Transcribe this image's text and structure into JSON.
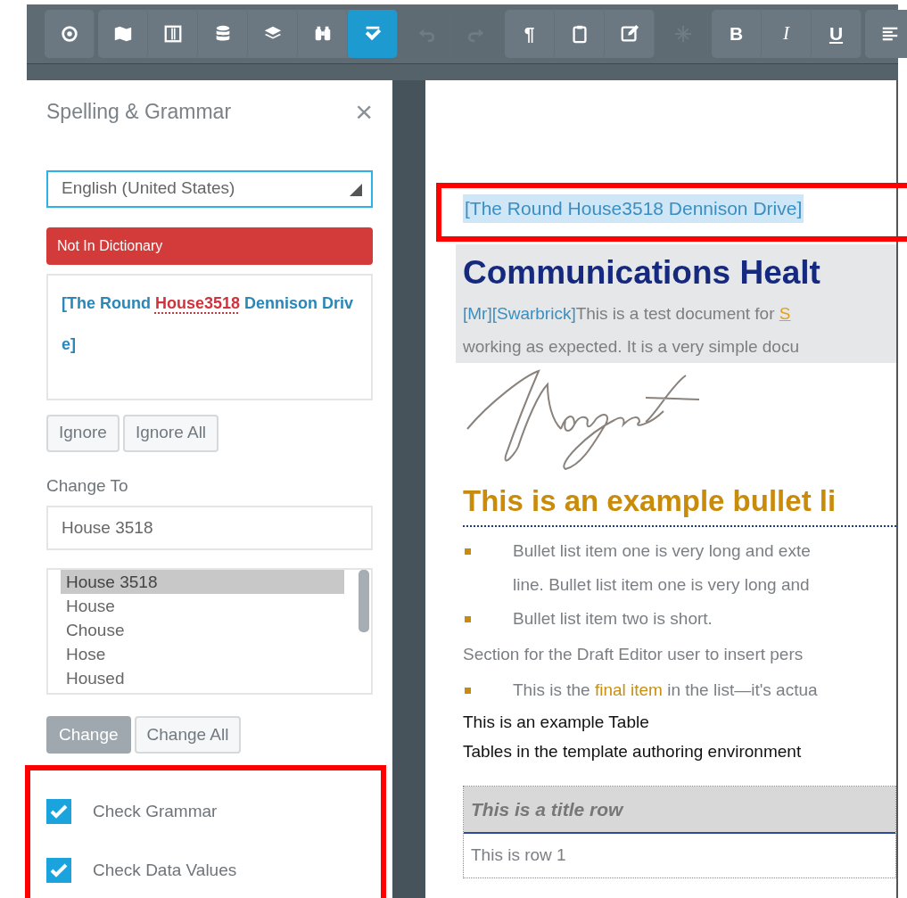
{
  "toolbar": {
    "groups": [
      {
        "buttons": [
          {
            "active": false,
            "disabled": false
          }
        ]
      },
      {
        "buttons": [
          {
            "active": false,
            "disabled": false
          },
          {
            "active": false,
            "disabled": false
          },
          {
            "active": false,
            "disabled": false
          },
          {
            "active": false,
            "disabled": false
          },
          {
            "active": false,
            "disabled": false
          },
          {
            "active": true,
            "disabled": false
          }
        ]
      },
      {
        "buttons": [
          {
            "active": false,
            "disabled": true
          },
          {
            "active": false,
            "disabled": true
          }
        ]
      },
      {
        "buttons": [
          {
            "label": "¶",
            "active": false,
            "disabled": false
          },
          {
            "active": false,
            "disabled": false
          },
          {
            "active": false,
            "disabled": false
          }
        ]
      },
      {
        "buttons": [
          {
            "active": false,
            "disabled": true
          }
        ]
      },
      {
        "buttons": [
          {
            "label": "B",
            "active": false,
            "disabled": false
          },
          {
            "label": "I",
            "active": false,
            "disabled": false
          },
          {
            "label": "U",
            "active": false,
            "disabled": false
          }
        ]
      },
      {
        "buttons": [
          {
            "active": false,
            "disabled": false
          }
        ]
      }
    ]
  },
  "panel": {
    "title": "Spelling & Grammar",
    "close": "×",
    "language": "English (United States)",
    "status": "Not In Dictionary",
    "context": [
      {
        "text": "[The Round ",
        "error": false
      },
      {
        "text": "House3518",
        "error": true
      },
      {
        "text": " Dennison Drive]",
        "error": false
      }
    ],
    "ignore_buttons": [
      "Ignore",
      "Ignore All"
    ],
    "change_to_label": "Change To",
    "change_to_value": "House 3518",
    "suggestions": [
      {
        "text": "House 3518",
        "selected": true
      },
      {
        "text": "House",
        "selected": false
      },
      {
        "text": "Chouse",
        "selected": false
      },
      {
        "text": "Hose",
        "selected": false
      },
      {
        "text": "Housed",
        "selected": false
      }
    ],
    "change_buttons": [
      {
        "label": "Change",
        "primary": true
      },
      {
        "label": "Change All",
        "primary": false
      }
    ],
    "options": [
      {
        "label": "Check Grammar",
        "checked": true
      },
      {
        "label": "Check Data Values",
        "checked": true
      }
    ],
    "options_highlighted": true
  },
  "document": {
    "address": "[The Round House3518 Dennison Drive]",
    "address_highlighted": true,
    "title": "Communications Healt",
    "intro": [
      [
        {
          "text": "[Mr][Swarbrick]",
          "kind": "field"
        },
        {
          "text": "This is a test document  for ",
          "kind": "plain"
        },
        {
          "text": "S",
          "kind": "link"
        }
      ],
      [
        {
          "text": "working as expected. It is a very simple docu",
          "kind": "plain"
        }
      ]
    ],
    "heading": "This is an example bullet li",
    "blocks": [
      {
        "kind": "bullet",
        "lines": [
          "Bullet list item one is very long and exte",
          "line. Bullet list item one is very long and"
        ]
      },
      {
        "kind": "bullet",
        "lines": [
          "Bullet list item two is short."
        ]
      },
      {
        "kind": "para",
        "lines": [
          "Section for the Draft Editor user to insert pers"
        ]
      },
      {
        "kind": "bullet",
        "parts": [
          {
            "text": "This is the ",
            "kind": "plain"
          },
          {
            "text": "final item",
            "kind": "accent"
          },
          {
            "text": " in the list—it's actua",
            "kind": "plain"
          }
        ]
      },
      {
        "kind": "dark",
        "lines": [
          "This is an example Table"
        ]
      },
      {
        "kind": "dark",
        "lines": [
          "Tables in the template authoring environment"
        ]
      }
    ],
    "table": {
      "title_row": "This is a title row",
      "rows": [
        "This is row 1"
      ]
    }
  }
}
